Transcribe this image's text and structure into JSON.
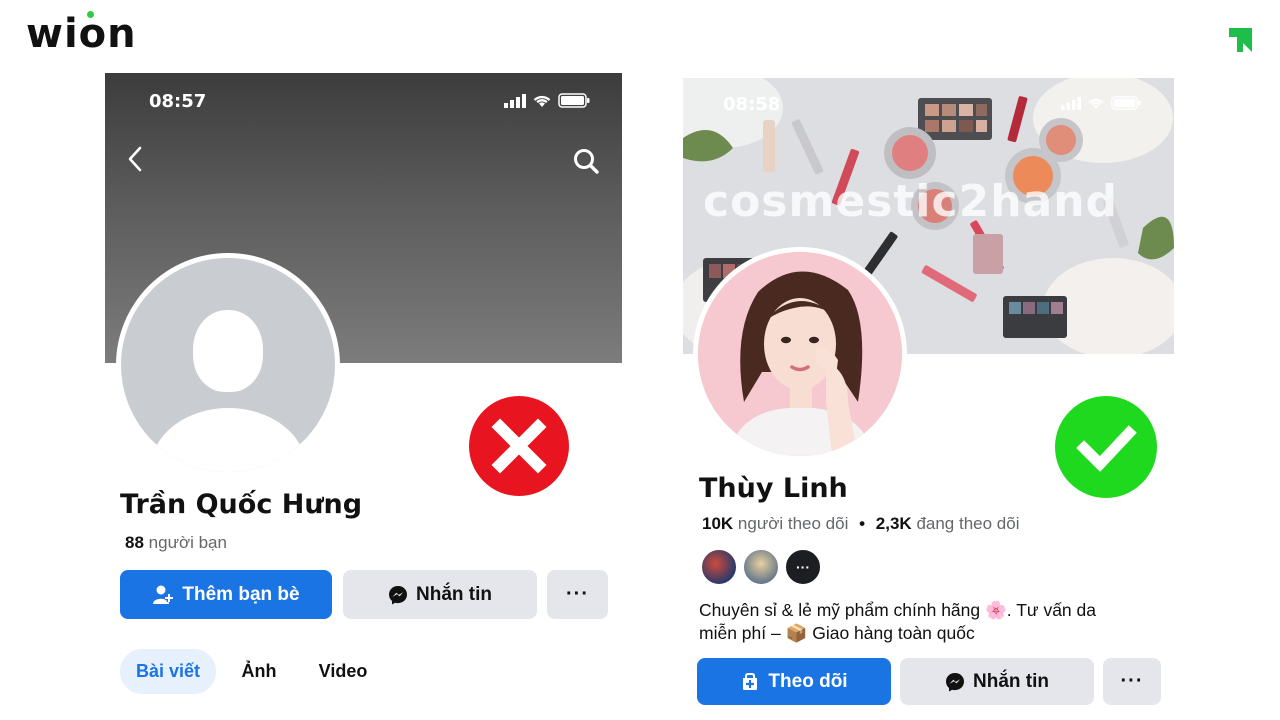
{
  "brand": {
    "logo_text": "wion"
  },
  "left_profile": {
    "status_time": "08:57",
    "name": "Trần Quốc Hưng",
    "friends_count": "88",
    "friends_label": "người bạn",
    "buttons": {
      "add_friend": "Thêm bạn bè",
      "message": "Nhắn tin",
      "more": "···"
    },
    "tabs": [
      {
        "label": "Bài viết",
        "active": true
      },
      {
        "label": "Ảnh",
        "active": false
      },
      {
        "label": "Video",
        "active": false
      }
    ],
    "verdict_icon": "red-x-icon"
  },
  "right_profile": {
    "status_time": "08:58",
    "cover_watermark": "cosmestic2hand",
    "name": "Thùy Linh",
    "followers_count": "10K",
    "followers_label": "người theo dõi",
    "separator": "•",
    "following_count": "2,3K",
    "following_label": "đang theo dõi",
    "bio_line1": "Chuyên sỉ & lẻ mỹ phẩm chính hãng 🌸. Tư vấn da",
    "bio_line2": "miễn phí – 📦 Giao hàng toàn quốc",
    "buttons": {
      "follow": "Theo dõi",
      "message": "Nhắn tin",
      "more": "···",
      "friends_more": "···"
    },
    "verdict_icon": "green-check-icon"
  },
  "colors": {
    "facebook_blue": "#1b74e4",
    "secondary_button": "#e4e6eb",
    "bad_red": "#e8141f",
    "good_green": "#1ed91e",
    "brand_green": "#2ecc40"
  }
}
